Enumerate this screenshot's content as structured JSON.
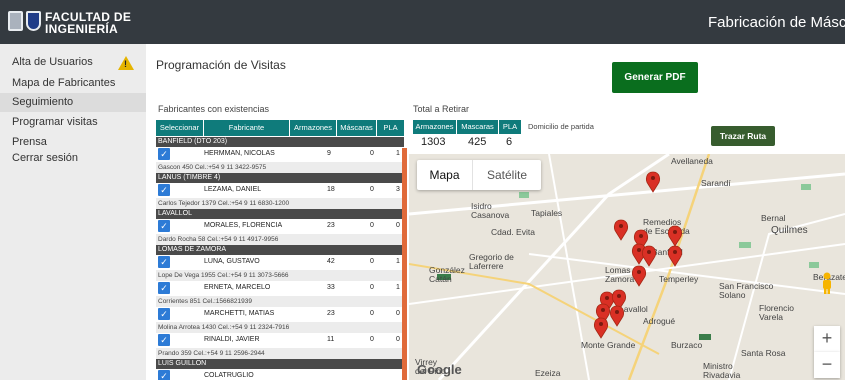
{
  "header": {
    "logo_line1": "FACULTAD DE",
    "logo_line2": "INGENIERÍA",
    "app_title": "Fabricación de Máscaras"
  },
  "sidebar": {
    "items": [
      {
        "label": "Alta de Usuarios"
      },
      {
        "label": "Mapa de Fabricantes"
      },
      {
        "label": "Seguimiento"
      },
      {
        "label": "Programar visitas"
      },
      {
        "label": "Prensa"
      },
      {
        "label": "Cerrar sesión"
      }
    ],
    "active_index": 2,
    "warning_glyph": "!"
  },
  "page": {
    "title": "Programación de Visitas",
    "pdf_button": "Generar PDF",
    "fab_label": "Fabricantes con existencias",
    "total_label": "Total a Retirar",
    "domicilio_label": "Domicilio de partida",
    "ruta_button": "Trazar Ruta"
  },
  "table": {
    "headers": [
      "Seleccionar",
      "Fabricante",
      "Armazones",
      "Máscaras",
      "PLA"
    ],
    "check_glyph": "✓",
    "groups": [
      {
        "zone": "BANFIELD (DTO 203)",
        "rows": [
          {
            "name": "HERMMAN, NICOLAS",
            "armazones": "9",
            "mascaras": "0",
            "pla": "1",
            "address": "Gascon 450 Cel.:+54 9 11 3422-9575"
          }
        ]
      },
      {
        "zone": "LANUS (TIMBRE 4)",
        "rows": [
          {
            "name": "LEZAMA, DANIEL",
            "armazones": "18",
            "mascaras": "0",
            "pla": "3",
            "address": "Carlos Tejedor 1379 Cel.:+54 9 11 6830-1200"
          }
        ]
      },
      {
        "zone": "LAVALLOL",
        "rows": [
          {
            "name": "MORALES, FLORENCIA",
            "armazones": "23",
            "mascaras": "0",
            "pla": "0",
            "address": "Dardo Rocha 58 Cel.:+54 9 11 4917-9956"
          }
        ]
      },
      {
        "zone": "LOMAS DE ZAMORA",
        "rows": [
          {
            "name": "LUNA, GUSTAVO",
            "armazones": "42",
            "mascaras": "0",
            "pla": "1",
            "address": "Lope De Vega 1955 Cel.:+54 9 11 3073-5666"
          },
          {
            "name": "ERNETA, MARCELO",
            "armazones": "33",
            "mascaras": "0",
            "pla": "1",
            "address": "Corrientes 851 Cel.:1566821939"
          },
          {
            "name": "MARCHETTI, MATIAS",
            "armazones": "23",
            "mascaras": "0",
            "pla": "0",
            "address": "Molina Arrotea 1430 Cel.:+54 9 11 2324-7916"
          },
          {
            "name": "RINALDI, JAVIER",
            "armazones": "11",
            "mascaras": "0",
            "pla": "0",
            "address": "Prando 359 Cel.:+54 9 11 2596-2944"
          }
        ]
      },
      {
        "zone": "LUIS GUILLON",
        "rows": [
          {
            "name": "COLATRUGLIO",
            "armazones": "",
            "mascaras": "",
            "pla": "",
            "address": ""
          }
        ]
      }
    ]
  },
  "totals": {
    "headers": [
      "Armazones",
      "Mascaras",
      "PLA"
    ],
    "values": [
      "1303",
      "425",
      "6"
    ]
  },
  "map": {
    "btn_map": "Mapa",
    "btn_sat": "Satélite",
    "zoom_in": "+",
    "zoom_out": "−",
    "google": "Google",
    "labels": [
      "Avellaneda",
      "Sarandí",
      "Isidro Casanova",
      "Tapiales",
      "Cdad. Evita",
      "Remedios de Escalada",
      "Bernal",
      "Quilmes",
      "Gregorio de Laferrere",
      "González Catán",
      "Banfield",
      "Lomas de Zamora",
      "Temperley",
      "San Francisco Solano",
      "Berazategui",
      "Lavallol",
      "Adrogué",
      "Florencio Varela",
      "Burzaco",
      "Monte Grande",
      "Santa Rosa",
      "Virrey del Pino",
      "Ezeiza",
      "Ministro Rivadavia"
    ],
    "pin_color": "#d93025"
  }
}
